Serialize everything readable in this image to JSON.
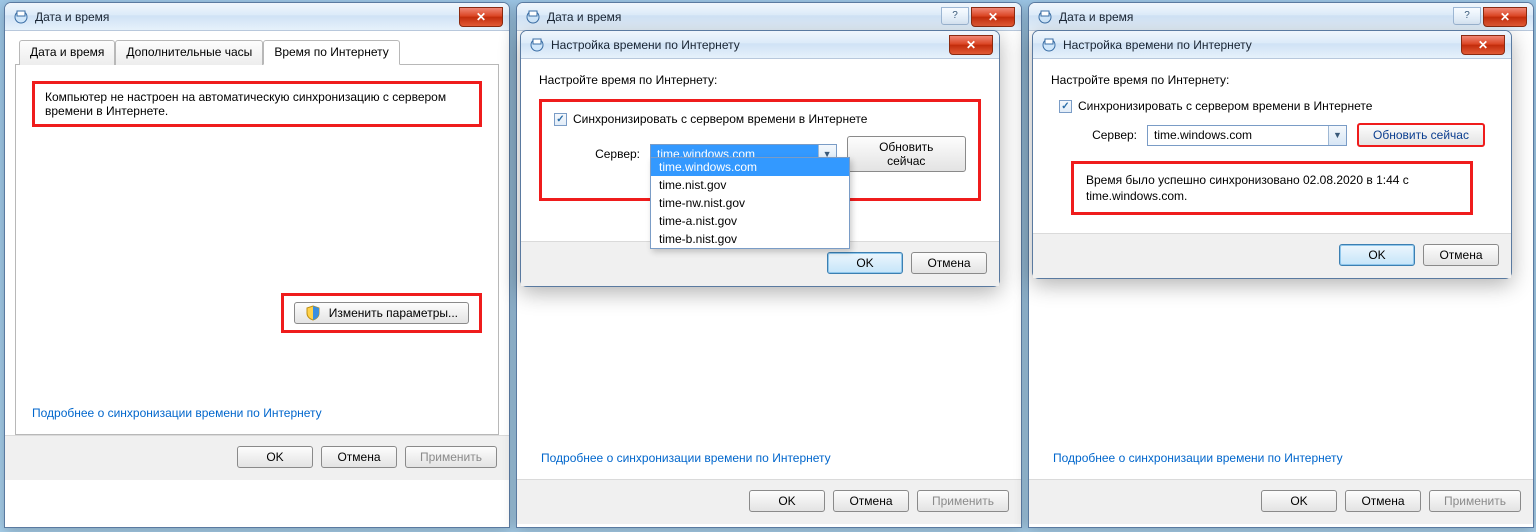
{
  "panel1": {
    "title": "Дата и время",
    "tabs": [
      "Дата и время",
      "Дополнительные часы",
      "Время по Интернету"
    ],
    "active_tab_index": 2,
    "message": "Компьютер не настроен на автоматическую синхронизацию с сервером времени в Интернете.",
    "change_btn": "Изменить параметры...",
    "more_link": "Подробнее о синхронизации времени по Интернету",
    "ok": "OK",
    "cancel": "Отмена",
    "apply": "Применить"
  },
  "dlg_common": {
    "title": "Настройка времени по Интернету",
    "instruct": "Настройте время по Интернету:",
    "sync_label": "Синхронизировать с сервером времени в Интернете",
    "server_label": "Сервер:",
    "update_btn": "Обновить сейчас",
    "ok": "OK",
    "cancel": "Отмена"
  },
  "dlg2": {
    "selected_server": "time.windows.com",
    "options": [
      "time.windows.com",
      "time.nist.gov",
      "time-nw.nist.gov",
      "time-a.nist.gov",
      "time-b.nist.gov"
    ]
  },
  "dlg3": {
    "selected_server": "time.windows.com",
    "success_msg": "Время было успешно синхронизовано 02.08.2020 в 1:44 с time.windows.com."
  },
  "back_panel": {
    "title": "Дата и время",
    "more_link": "Подробнее о синхронизации времени по Интернету",
    "ok": "OK",
    "cancel": "Отмена",
    "apply": "Применить"
  }
}
